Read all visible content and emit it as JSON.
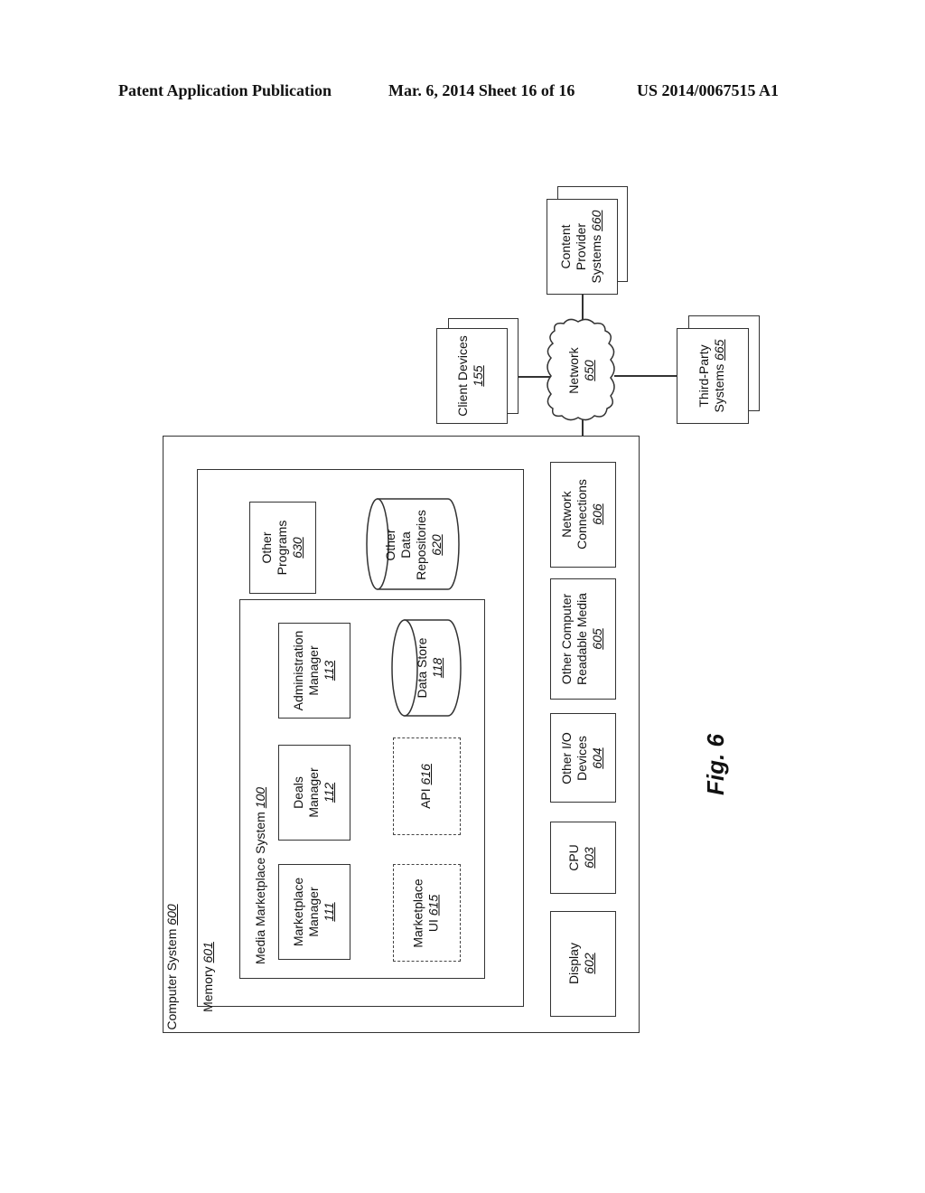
{
  "header": {
    "left": "Patent Application Publication",
    "middle": "Mar. 6, 2014   Sheet 16 of 16",
    "right": "US 2014/0067515 A1"
  },
  "figure_label": "Fig. 6",
  "diagram": {
    "computer_system": {
      "label": "Computer System",
      "ref": "600"
    },
    "memory": {
      "label": "Memory",
      "ref": "601"
    },
    "media_marketplace_system": {
      "label": "Media Marketplace System",
      "ref": "100"
    },
    "marketplace_manager": {
      "line1": "Marketplace",
      "line2": "Manager",
      "ref": "111"
    },
    "deals_manager": {
      "line1": "Deals",
      "line2": "Manager",
      "ref": "112"
    },
    "administration_manager": {
      "line1": "Administration",
      "line2": "Manager",
      "ref": "113"
    },
    "marketplace_ui": {
      "line1": "Marketplace",
      "line2": "UI",
      "ref": "615"
    },
    "api": {
      "label": "API",
      "ref": "616"
    },
    "data_store": {
      "label": "Data Store",
      "ref": "118"
    },
    "other_programs": {
      "line1": "Other",
      "line2": "Programs",
      "ref": "630"
    },
    "other_data_repositories": {
      "line1": "Other",
      "line2": "Data",
      "line3": "Repositories",
      "ref": "620"
    },
    "display": {
      "label": "Display",
      "ref": "602"
    },
    "cpu": {
      "label": "CPU",
      "ref": "603"
    },
    "other_io_devices": {
      "line1": "Other I/O",
      "line2": "Devices",
      "ref": "604"
    },
    "other_crm": {
      "line1": "Other Computer",
      "line2": "Readable Media",
      "ref": "605"
    },
    "network_connections": {
      "line1": "Network",
      "line2": "Connections",
      "ref": "606"
    },
    "network": {
      "label": "Network",
      "ref": "650"
    },
    "client_devices": {
      "label": "Client Devices",
      "ref": "155"
    },
    "content_provider_systems": {
      "line1": "Content",
      "line2": "Provider",
      "line3": "Systems",
      "ref": "660"
    },
    "third_party_systems": {
      "line1": "Third-Party",
      "line2": "Systems",
      "ref": "665"
    }
  }
}
